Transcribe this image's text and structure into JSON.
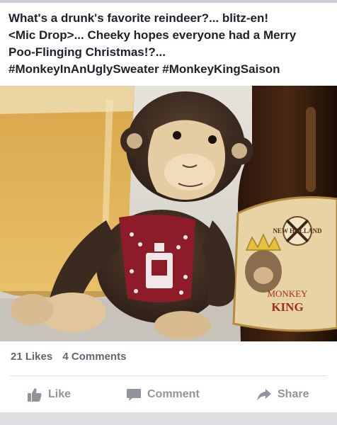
{
  "post": {
    "caption_lines": [
      "What's a drunk's favorite reindeer?... blitz-en!",
      "<Mic Drop>... Cheeky hopes everyone had a Merry",
      "Poo-Flinging Christmas!?...",
      "#MonkeyInAnUglySweater #MonkeyKingSaison"
    ],
    "photo": {
      "label_brand": "NEW HOLLAND",
      "label_title_1": "MONKEY",
      "label_title_2": "KING"
    }
  },
  "stats": {
    "likes": "21 Likes",
    "comments": "4 Comments"
  },
  "actions": {
    "like": "Like",
    "comment": "Comment",
    "share": "Share"
  },
  "colors": {
    "text": "#1d2129",
    "muted": "#90949c",
    "counts": "#606770"
  }
}
